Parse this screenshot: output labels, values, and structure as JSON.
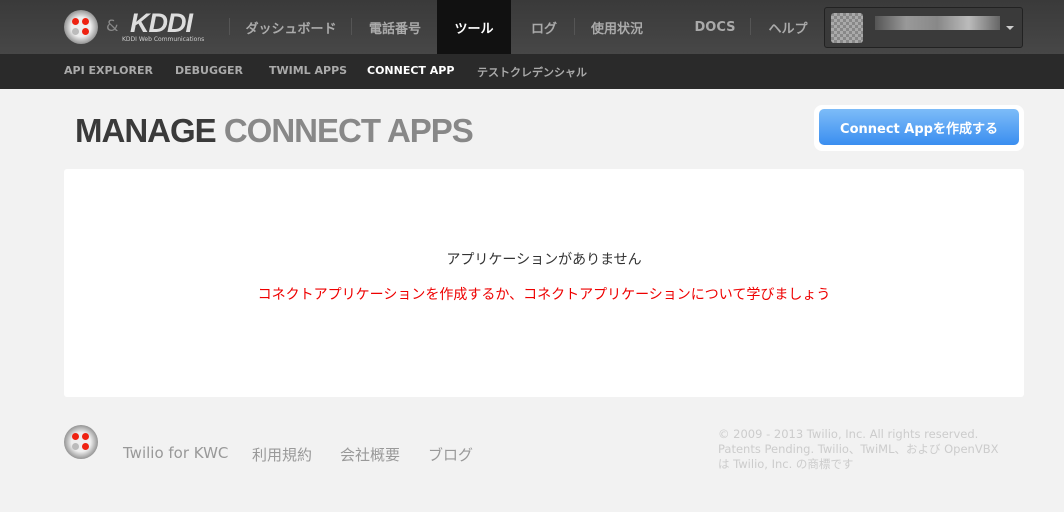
{
  "header": {
    "amp": "&",
    "brand": "KDDI",
    "brand_sub": "KDDI Web Communications",
    "nav": [
      "ダッシュボード",
      "電話番号",
      "ツール",
      "ログ",
      "使用状況",
      "DOCS",
      "ヘルプ"
    ],
    "active": "ツール"
  },
  "subnav": [
    "API EXPLORER",
    "DEBUGGER",
    "TWIML APPS",
    "CONNECT APP",
    "テストクレデンシャル"
  ],
  "page": {
    "title_a": "MANAGE",
    "title_b": "CONNECT APPS",
    "create_button": "Connect Appを作成する",
    "empty": "アプリケーションがありません",
    "link_create": "コネクトアプリケーションを作成する",
    "link_sep": "か、",
    "link_learn": "コネクトアプリケーションについて学びましょう"
  },
  "footer": {
    "links": [
      "Twilio for KWC",
      "利用規約",
      "会社概要",
      "ブログ"
    ],
    "copyright": [
      "© 2009 - 2013 Twilio, Inc. All rights reserved.",
      "Patents Pending. Twilio、TwiML、および OpenVBX",
      "は Twilio, Inc. の商標です"
    ]
  }
}
